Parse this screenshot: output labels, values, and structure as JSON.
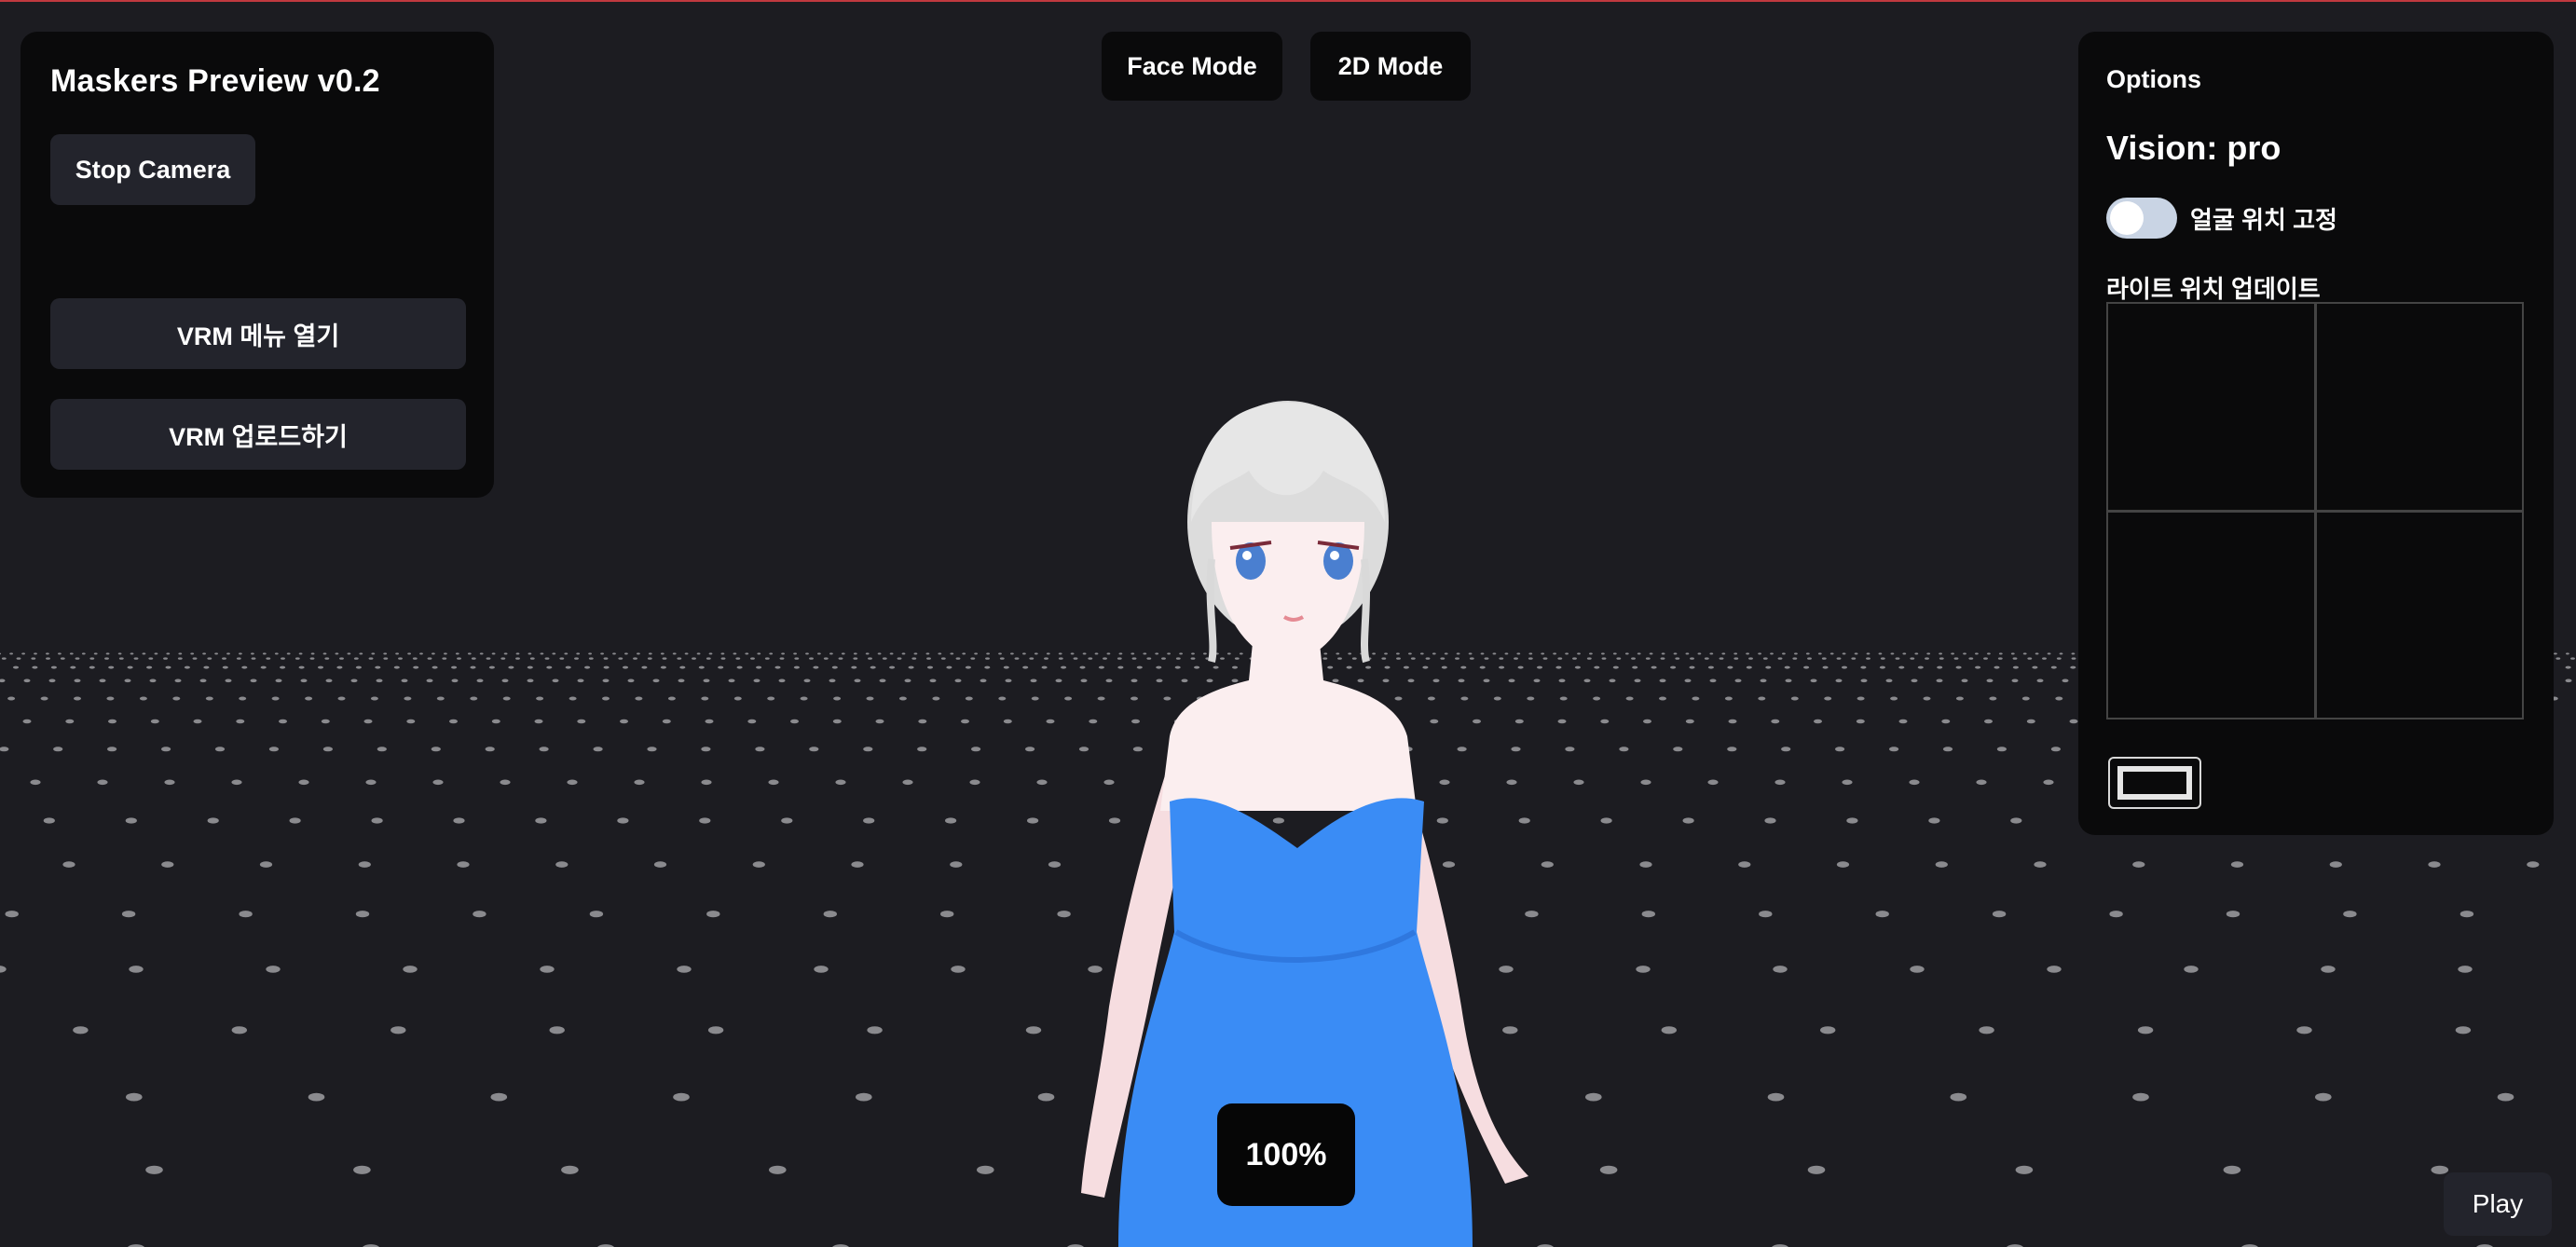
{
  "app": {
    "title": "Maskers Preview v0.2"
  },
  "left_panel": {
    "stop_camera": "Stop Camera",
    "vrm_menu": "VRM 메뉴 열기",
    "vrm_upload": "VRM 업로드하기"
  },
  "mode_buttons": {
    "face": "Face Mode",
    "two_d": "2D Mode"
  },
  "options": {
    "heading": "Options",
    "vision": "Vision: pro",
    "face_lock_label": "얼굴 위치 고정",
    "face_lock_on": false,
    "light_update_label": "라이트 위치 업데이트"
  },
  "viewport": {
    "zoom": "100%"
  },
  "play": "Play",
  "colors": {
    "background": "#1c1c21",
    "panel": "#0a0a0b",
    "button": "#23242c",
    "dress": "#3a8cf5",
    "accent_line": "#c0393f"
  },
  "icons": {
    "avatar": "vrm-avatar",
    "floor": "dot-grid-floor"
  }
}
